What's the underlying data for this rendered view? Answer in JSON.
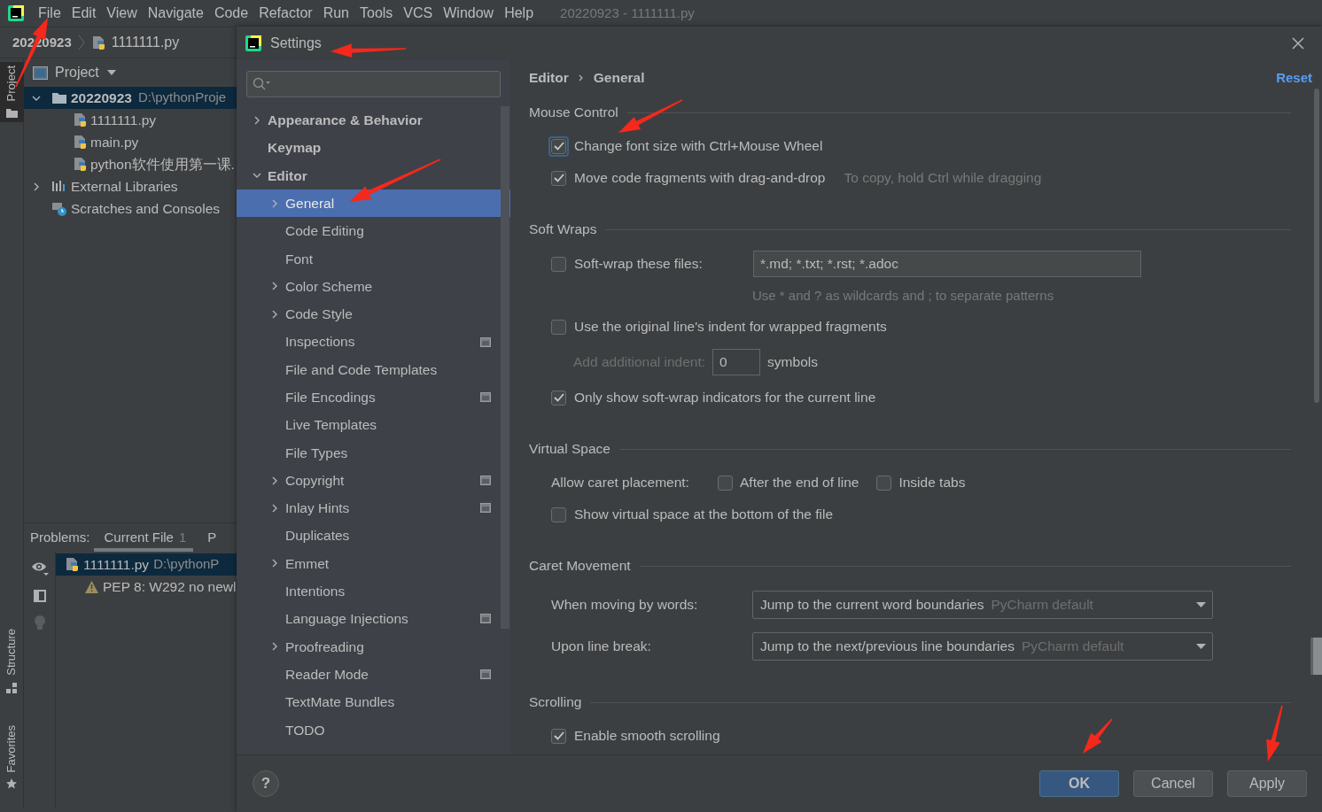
{
  "menu_bar": {
    "items": [
      {
        "label": "File"
      },
      {
        "label": "Edit"
      },
      {
        "label": "View"
      },
      {
        "label": "Navigate"
      },
      {
        "label": "Code"
      },
      {
        "label": "Refactor"
      },
      {
        "label": "Run"
      },
      {
        "label": "Tools"
      },
      {
        "label": "VCS"
      },
      {
        "label": "Window"
      },
      {
        "label": "Help"
      }
    ],
    "title": "20220923 - 1111111.py"
  },
  "breadcrumb": {
    "folder": "20220923",
    "file": "1111111.py"
  },
  "tool_stripe": [
    {
      "label": "Project",
      "selected": true,
      "kind": "project"
    },
    {
      "label": "Structure",
      "selected": false,
      "kind": "structure"
    },
    {
      "label": "Favorites",
      "selected": false,
      "kind": "favorites"
    }
  ],
  "project_panel": {
    "title": "Project",
    "tree": [
      {
        "label": "20220923",
        "path": "D:\\pythonProje",
        "kind": "folder",
        "expanded": true,
        "selected": true,
        "children": [
          {
            "label": "1111111.py",
            "kind": "python",
            "selected": false
          },
          {
            "label": "main.py",
            "kind": "python",
            "selected": false
          },
          {
            "label": "python软件使用第一课.",
            "kind": "python",
            "selected": false
          }
        ]
      },
      {
        "label": "External Libraries",
        "kind": "library",
        "expanded": false,
        "selected": false
      },
      {
        "label": "Scratches and Consoles",
        "kind": "scratch",
        "selected": false
      }
    ]
  },
  "problems_panel": {
    "label": "Problems:",
    "tabs": [
      {
        "label": "Current File",
        "count": "1",
        "selected": true
      },
      {
        "label": "P",
        "selected": false
      }
    ],
    "tree": [
      {
        "label": "1111111.py",
        "path": "D:\\pythonP",
        "kind": "file",
        "selected": true
      },
      {
        "label": "PEP 8: W292 no newl",
        "kind": "warning",
        "selected": false
      }
    ]
  },
  "settings": {
    "title": "Settings",
    "tree": [
      {
        "label": "Appearance & Behavior",
        "expanded": false,
        "selected": false,
        "project_level": false
      },
      {
        "label": "Keymap",
        "selected": false,
        "project_level": false
      },
      {
        "label": "Editor",
        "expanded": true,
        "selected": false,
        "project_level": false,
        "children": [
          {
            "label": "General",
            "expanded": false,
            "selected": true,
            "project_level": false
          },
          {
            "label": "Code Editing",
            "selected": false,
            "project_level": false
          },
          {
            "label": "Font",
            "selected": false,
            "project_level": false
          },
          {
            "label": "Color Scheme",
            "expanded": false,
            "selected": false,
            "project_level": false
          },
          {
            "label": "Code Style",
            "expanded": false,
            "selected": false,
            "project_level": false
          },
          {
            "label": "Inspections",
            "selected": false,
            "project_level": true
          },
          {
            "label": "File and Code Templates",
            "selected": false,
            "project_level": false
          },
          {
            "label": "File Encodings",
            "selected": false,
            "project_level": true
          },
          {
            "label": "Live Templates",
            "selected": false,
            "project_level": false
          },
          {
            "label": "File Types",
            "selected": false,
            "project_level": false
          },
          {
            "label": "Copyright",
            "expanded": false,
            "selected": false,
            "project_level": true
          },
          {
            "label": "Inlay Hints",
            "expanded": false,
            "selected": false,
            "project_level": true
          },
          {
            "label": "Duplicates",
            "selected": false,
            "project_level": false
          },
          {
            "label": "Emmet",
            "expanded": false,
            "selected": false,
            "project_level": false
          },
          {
            "label": "Intentions",
            "selected": false,
            "project_level": false
          },
          {
            "label": "Language Injections",
            "selected": false,
            "project_level": true
          },
          {
            "label": "Proofreading",
            "expanded": false,
            "selected": false,
            "project_level": false
          },
          {
            "label": "Reader Mode",
            "selected": false,
            "project_level": true
          },
          {
            "label": "TextMate Bundles",
            "selected": false,
            "project_level": false
          },
          {
            "label": "TODO",
            "selected": false,
            "project_level": false
          }
        ]
      }
    ],
    "breadcrumb": [
      "Editor",
      "General"
    ],
    "reset": "Reset",
    "sections": [
      {
        "title": "Mouse Control",
        "rows": [
          {
            "kind": "checkbox",
            "label": "Change font size with Ctrl+Mouse Wheel",
            "checked": true,
            "focused": true
          },
          {
            "kind": "checkbox",
            "label": "Move code fragments with drag-and-drop",
            "checked": true,
            "focused": false,
            "hint": "To copy, hold Ctrl while dragging"
          }
        ]
      },
      {
        "title": "Soft Wraps",
        "rows": [
          {
            "kind": "checkbox_field",
            "label": "Soft-wrap these files:",
            "checked": false,
            "value": "*.md; *.txt; *.rst; *.adoc"
          },
          {
            "kind": "note",
            "text": "Use * and ? as wildcards and ; to separate patterns"
          },
          {
            "kind": "checkbox",
            "label": "Use the original line's indent for wrapped fragments",
            "checked": false,
            "focused": false
          },
          {
            "kind": "number_field",
            "label": "Add additional indent:",
            "value": "0",
            "suffix": "symbols",
            "disabled": true
          },
          {
            "kind": "checkbox",
            "label": "Only show soft-wrap indicators for the current line",
            "checked": true,
            "focused": false
          }
        ]
      },
      {
        "title": "Virtual Space",
        "rows": [
          {
            "kind": "options",
            "label": "Allow caret placement:",
            "options": [
              {
                "label": "After the end of line",
                "checked": false
              },
              {
                "label": "Inside tabs",
                "checked": false
              }
            ]
          },
          {
            "kind": "checkbox",
            "label": "Show virtual space at the bottom of the file",
            "checked": false,
            "focused": false
          }
        ]
      },
      {
        "title": "Caret Movement",
        "rows": [
          {
            "kind": "dropdown",
            "label": "When moving by words:",
            "value": "Jump to the current word boundaries",
            "hint": "PyCharm default"
          },
          {
            "kind": "dropdown",
            "label": "Upon line break:",
            "value": "Jump to the next/previous line boundaries",
            "hint": "PyCharm default"
          }
        ]
      },
      {
        "title": "Scrolling",
        "rows": [
          {
            "kind": "checkbox",
            "label": "Enable smooth scrolling",
            "checked": true,
            "focused": false
          }
        ]
      }
    ],
    "buttons": [
      {
        "label": "OK",
        "kind": "primary"
      },
      {
        "label": "Cancel",
        "kind": "normal"
      },
      {
        "label": "Apply",
        "kind": "normal"
      }
    ],
    "help_button": "?"
  }
}
